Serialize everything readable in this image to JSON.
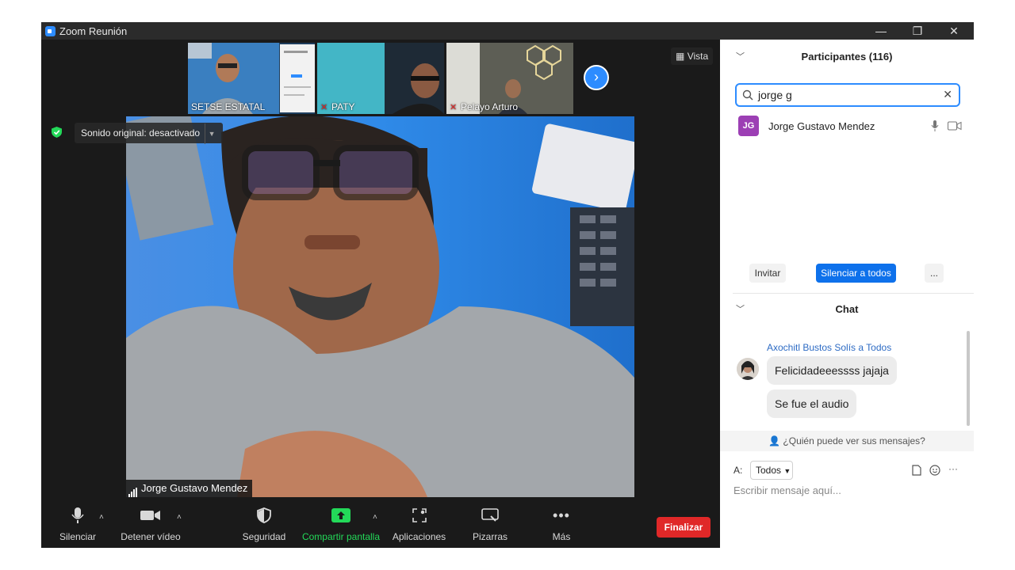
{
  "window": {
    "title": "Zoom Reunión",
    "minimize": "—",
    "restore": "❐",
    "close": "✕"
  },
  "thumbnails": [
    {
      "label": "SETSE ESTATAL",
      "muted": false
    },
    {
      "label": "PATY",
      "muted": true
    },
    {
      "label": "Pelayo Arturo",
      "muted": true
    }
  ],
  "view_button": "Vista",
  "next_page_icon": "›",
  "main_video": {
    "audio_notice": "Sonido original: desactivado",
    "speaker_name": "Jorge Gustavo Mendez"
  },
  "toolbar": {
    "mute": "Silenciar",
    "stop_video": "Detener vídeo",
    "security": "Seguridad",
    "share_screen": "Compartir pantalla",
    "apps": "Aplicaciones",
    "whiteboards": "Pizarras",
    "more": "Más",
    "end": "Finalizar",
    "caret": "˄"
  },
  "participants": {
    "header": "Participantes (116)",
    "search_value": "jorge g",
    "results": [
      {
        "initials": "JG",
        "name": "Jorge Gustavo Mendez"
      }
    ],
    "invite": "Invitar",
    "mute_all": "Silenciar a todos",
    "more": "..."
  },
  "chat": {
    "header": "Chat",
    "sender": "Axochitl Bustos Solís a Todos",
    "messages": [
      "Felicidadeeessss jajaja",
      "Se fue el audio"
    ],
    "who_can_see": "¿Quién puede ver sus mensajes?",
    "to_label": "A:",
    "to_value": "Todos",
    "input_placeholder": "Escribir mensaje aquí...",
    "more": "···"
  },
  "colors": {
    "accent": "#2d8cff",
    "share_green": "#23d959",
    "end_red": "#e02828",
    "avatar_purple": "#9c3fb4"
  }
}
